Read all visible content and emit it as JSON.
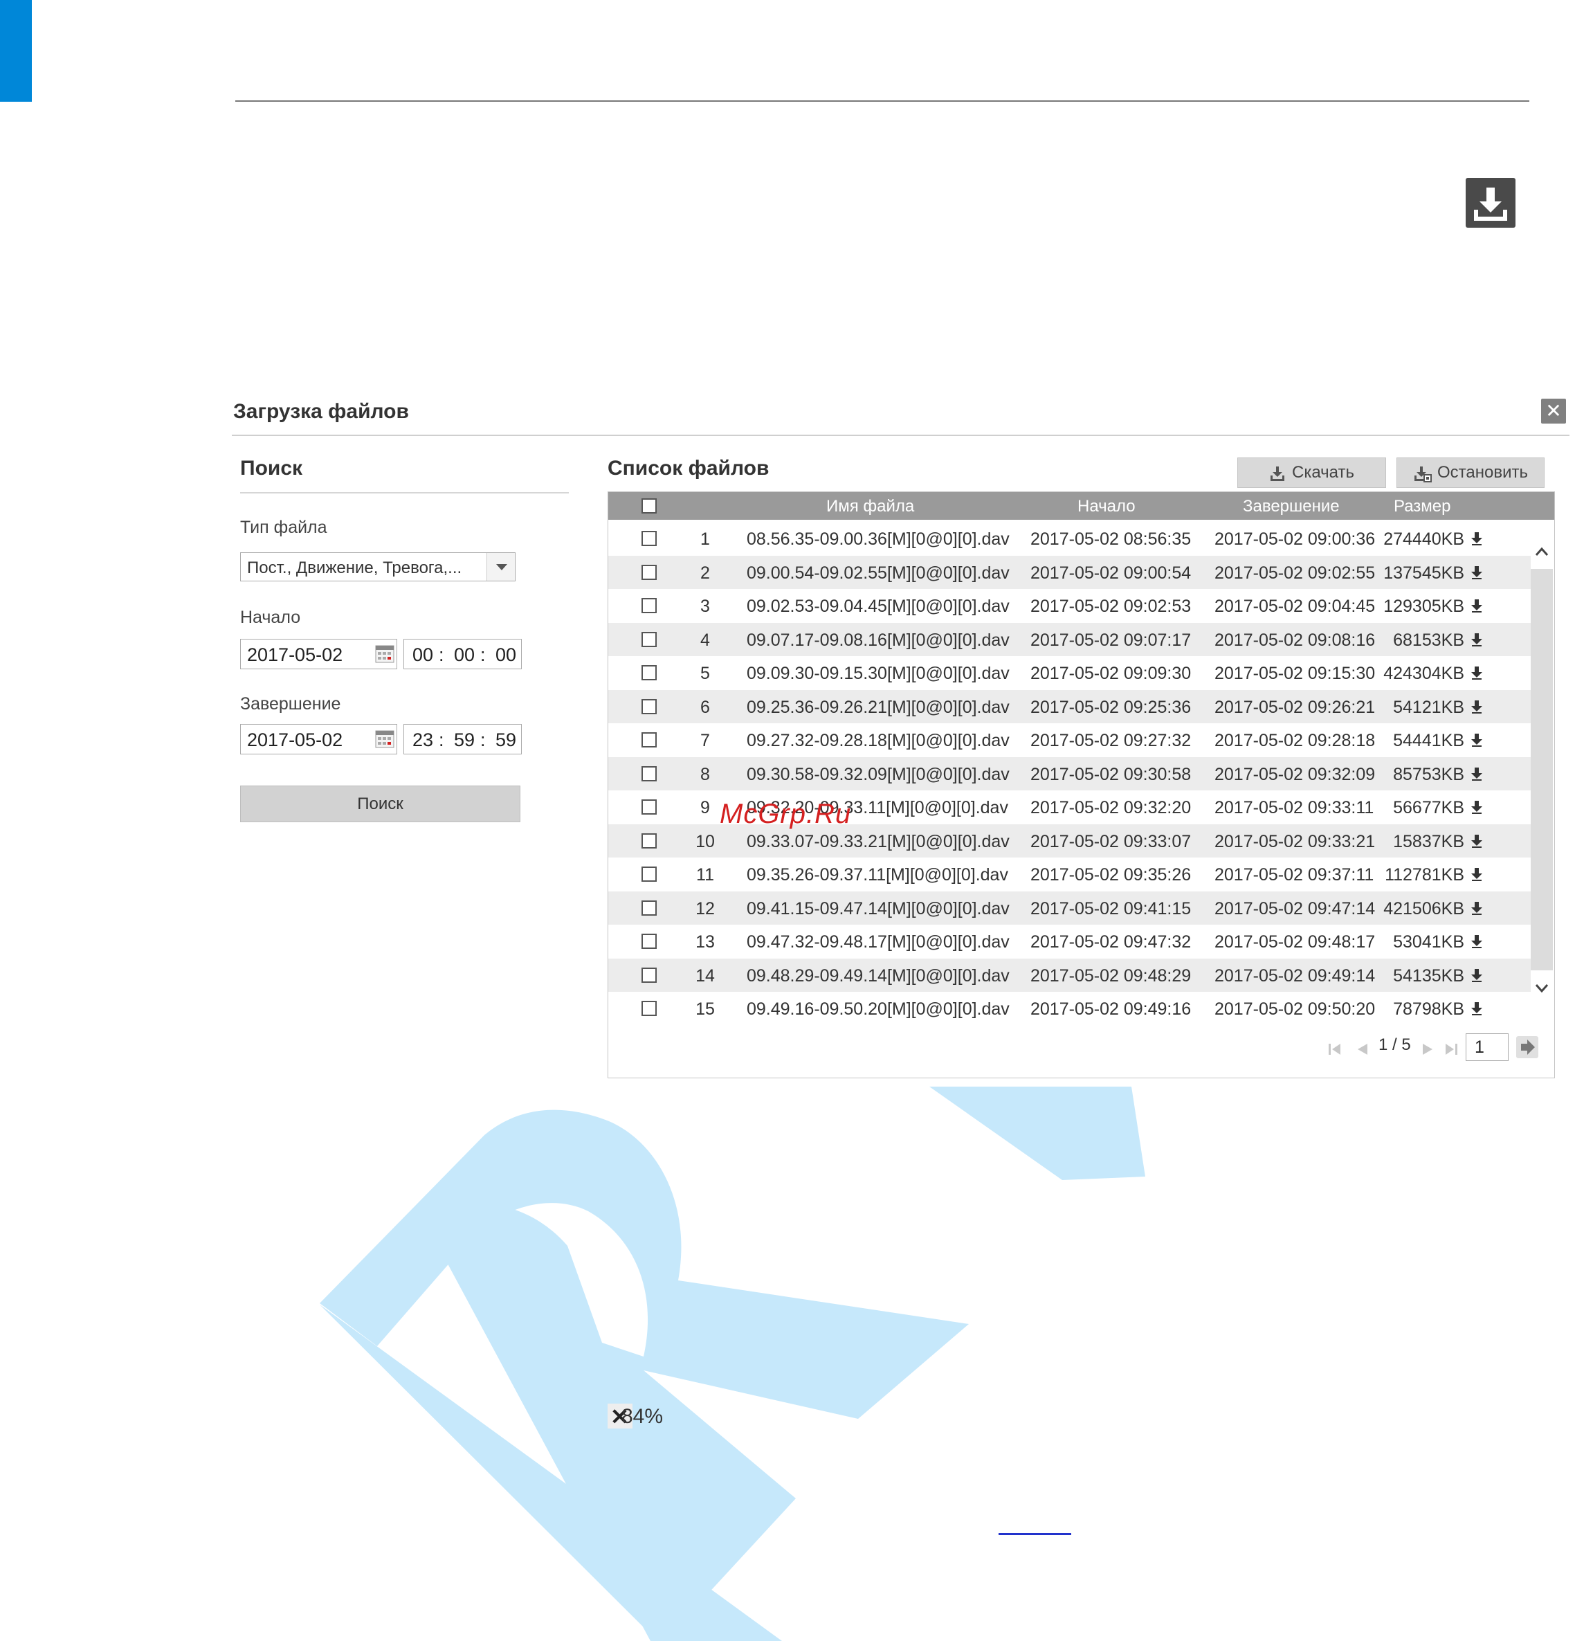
{
  "dialog": {
    "title": "Загрузка файлов"
  },
  "search": {
    "heading": "Поиск",
    "file_type_label": "Тип файла",
    "file_type_value": "Пост., Движение, Тревога,...",
    "start_label": "Начало",
    "start_date": "2017-05-02",
    "start_time": {
      "h": "00",
      "m": "00",
      "s": "00"
    },
    "end_label": "Завершение",
    "end_date": "2017-05-02",
    "end_time": {
      "h": "23",
      "m": "59",
      "s": "59"
    },
    "time_separator": ":",
    "search_button": "Поиск"
  },
  "file_list": {
    "heading": "Список файлов",
    "download_button": "Скачать",
    "stop_button": "Остановить",
    "columns": [
      "Имя файла",
      "Начало",
      "Завершение",
      "Размер"
    ],
    "rows": [
      {
        "n": "1",
        "name": "08.56.35-09.00.36[M][0@0][0].dav",
        "start": "2017-05-02 08:56:35",
        "end": "2017-05-02 09:00:36",
        "size": "274440KB"
      },
      {
        "n": "2",
        "name": "09.00.54-09.02.55[M][0@0][0].dav",
        "start": "2017-05-02 09:00:54",
        "end": "2017-05-02 09:02:55",
        "size": "137545KB"
      },
      {
        "n": "3",
        "name": "09.02.53-09.04.45[M][0@0][0].dav",
        "start": "2017-05-02 09:02:53",
        "end": "2017-05-02 09:04:45",
        "size": "129305KB"
      },
      {
        "n": "4",
        "name": "09.07.17-09.08.16[M][0@0][0].dav",
        "start": "2017-05-02 09:07:17",
        "end": "2017-05-02 09:08:16",
        "size": "68153KB"
      },
      {
        "n": "5",
        "name": "09.09.30-09.15.30[M][0@0][0].dav",
        "start": "2017-05-02 09:09:30",
        "end": "2017-05-02 09:15:30",
        "size": "424304KB"
      },
      {
        "n": "6",
        "name": "09.25.36-09.26.21[M][0@0][0].dav",
        "start": "2017-05-02 09:25:36",
        "end": "2017-05-02 09:26:21",
        "size": "54121KB"
      },
      {
        "n": "7",
        "name": "09.27.32-09.28.18[M][0@0][0].dav",
        "start": "2017-05-02 09:27:32",
        "end": "2017-05-02 09:28:18",
        "size": "54441KB"
      },
      {
        "n": "8",
        "name": "09.30.58-09.32.09[M][0@0][0].dav",
        "start": "2017-05-02 09:30:58",
        "end": "2017-05-02 09:32:09",
        "size": "85753KB"
      },
      {
        "n": "9",
        "name": "09.32.20-09.33.11[M][0@0][0].dav",
        "start": "2017-05-02 09:32:20",
        "end": "2017-05-02 09:33:11",
        "size": "56677KB"
      },
      {
        "n": "10",
        "name": "09.33.07-09.33.21[M][0@0][0].dav",
        "start": "2017-05-02 09:33:07",
        "end": "2017-05-02 09:33:21",
        "size": "15837KB"
      },
      {
        "n": "11",
        "name": "09.35.26-09.37.11[M][0@0][0].dav",
        "start": "2017-05-02 09:35:26",
        "end": "2017-05-02 09:37:11",
        "size": "112781KB"
      },
      {
        "n": "12",
        "name": "09.41.15-09.47.14[M][0@0][0].dav",
        "start": "2017-05-02 09:41:15",
        "end": "2017-05-02 09:47:14",
        "size": "421506KB"
      },
      {
        "n": "13",
        "name": "09.47.32-09.48.17[M][0@0][0].dav",
        "start": "2017-05-02 09:47:32",
        "end": "2017-05-02 09:48:17",
        "size": "53041KB"
      },
      {
        "n": "14",
        "name": "09.48.29-09.49.14[M][0@0][0].dav",
        "start": "2017-05-02 09:48:29",
        "end": "2017-05-02 09:49:14",
        "size": "54135KB"
      },
      {
        "n": "15",
        "name": "09.49.16-09.50.20[M][0@0][0].dav",
        "start": "2017-05-02 09:49:16",
        "end": "2017-05-02 09:50:20",
        "size": "78798KB"
      }
    ],
    "pagination": {
      "indicator": "1 / 5",
      "page_input": "1"
    }
  },
  "watermark_text": "McGrp.Ru",
  "progress_text": "84%",
  "colors": {
    "accent_blue": "#0087d8",
    "watermark_light_blue": "#c6e8fb",
    "header_gray": "#9a9a9a",
    "watermark_red": "#d42020"
  },
  "icons": [
    "download-icon",
    "close-icon",
    "calendar-icon",
    "dropdown-arrow-icon",
    "row-download-icon",
    "first-page-icon",
    "prev-page-icon",
    "next-page-icon",
    "last-page-icon",
    "go-page-icon",
    "scroll-up-icon",
    "scroll-down-icon",
    "stop-download-icon"
  ]
}
